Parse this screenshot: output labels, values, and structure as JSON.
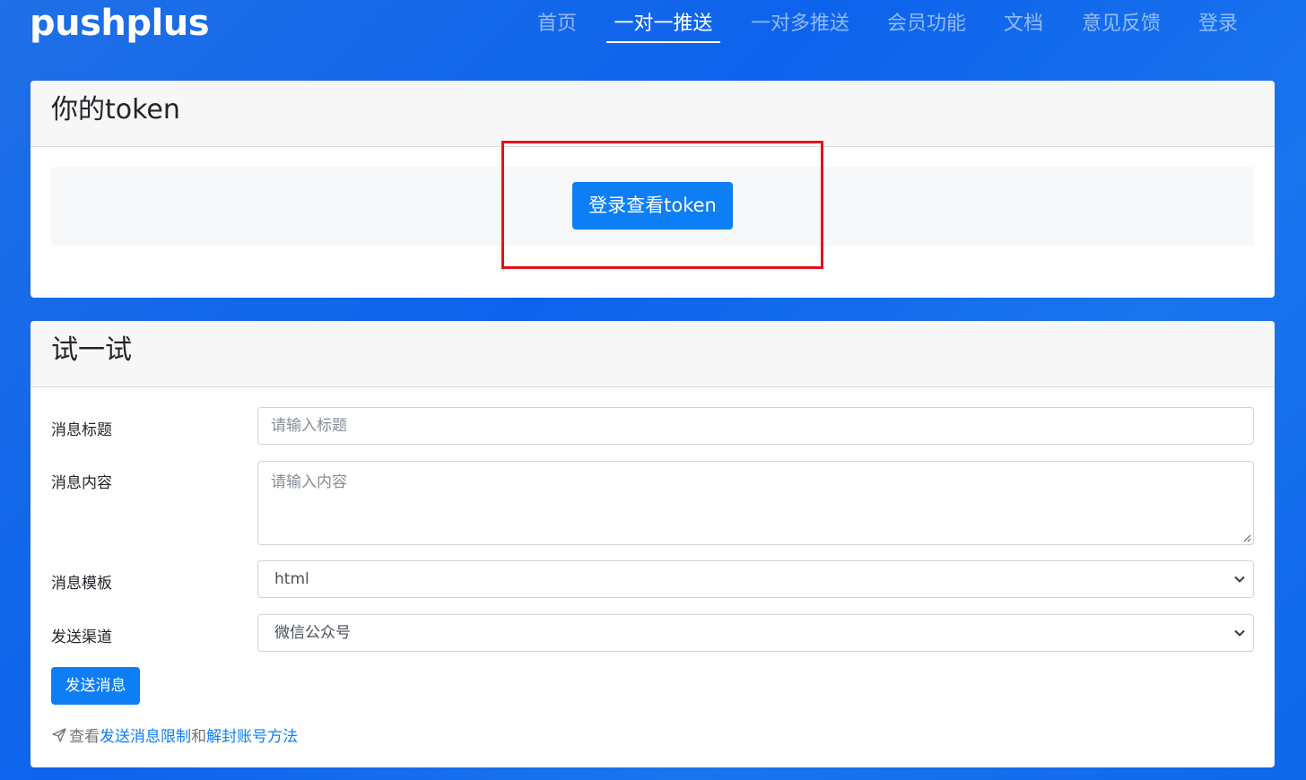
{
  "brand": {
    "logo_text": "pushplus"
  },
  "nav": {
    "items": [
      {
        "label": "首页"
      },
      {
        "label": "一对一推送",
        "active": true
      },
      {
        "label": "一对多推送"
      },
      {
        "label": "会员功能"
      },
      {
        "label": "文档"
      },
      {
        "label": "意见反馈"
      },
      {
        "label": "登录"
      }
    ]
  },
  "token_card": {
    "title": "你的token",
    "login_button": "登录查看token"
  },
  "try_card": {
    "title": "试一试",
    "fields": {
      "title_label": "消息标题",
      "title_placeholder": "请输入标题",
      "content_label": "消息内容",
      "content_placeholder": "请输入内容",
      "template_label": "消息模板",
      "template_value": "html",
      "channel_label": "发送渠道",
      "channel_value": "微信公众号"
    },
    "send_button": "发送消息",
    "footer": {
      "prefix": "查看",
      "link1": "发送消息限制",
      "middle": "和",
      "link2": "解封账号方法"
    }
  },
  "colors": {
    "background": "#0d63ec",
    "primary": "#0d7ef5",
    "highlight": "#e5121a"
  }
}
